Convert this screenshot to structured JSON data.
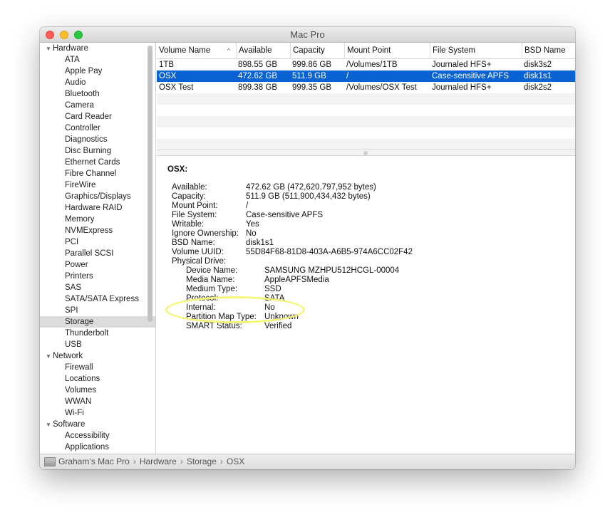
{
  "window": {
    "title": "Mac Pro"
  },
  "sidebar": {
    "groups": [
      {
        "label": "Hardware",
        "items": [
          "ATA",
          "Apple Pay",
          "Audio",
          "Bluetooth",
          "Camera",
          "Card Reader",
          "Controller",
          "Diagnostics",
          "Disc Burning",
          "Ethernet Cards",
          "Fibre Channel",
          "FireWire",
          "Graphics/Displays",
          "Hardware RAID",
          "Memory",
          "NVMExpress",
          "PCI",
          "Parallel SCSI",
          "Power",
          "Printers",
          "SAS",
          "SATA/SATA Express",
          "SPI",
          "Storage",
          "Thunderbolt",
          "USB"
        ]
      },
      {
        "label": "Network",
        "items": [
          "Firewall",
          "Locations",
          "Volumes",
          "WWAN",
          "Wi-Fi"
        ]
      },
      {
        "label": "Software",
        "items": [
          "Accessibility",
          "Applications"
        ]
      }
    ],
    "selected": "Storage"
  },
  "table": {
    "columns": [
      "Volume Name",
      "Available",
      "Capacity",
      "Mount Point",
      "File System",
      "BSD Name"
    ],
    "sort_icon": "chevron-up-icon",
    "rows": [
      [
        "1TB",
        "898.55 GB",
        "999.86 GB",
        "/Volumes/1TB",
        "Journaled HFS+",
        "disk3s2"
      ],
      [
        "OSX",
        "472.62 GB",
        "511.9 GB",
        "/",
        "Case-sensitive APFS",
        "disk1s1"
      ],
      [
        "OSX Test",
        "899.38 GB",
        "999.35 GB",
        "/Volumes/OSX Test",
        "Journaled HFS+",
        "disk2s2"
      ]
    ],
    "selected_row": 1
  },
  "detail": {
    "title": "OSX:",
    "fields": [
      {
        "label": "Available:",
        "value": "472.62 GB (472,620,797,952 bytes)"
      },
      {
        "label": "Capacity:",
        "value": "511.9 GB (511,900,434,432 bytes)"
      },
      {
        "label": "Mount Point:",
        "value": "/"
      },
      {
        "label": "File System:",
        "value": "Case-sensitive APFS"
      },
      {
        "label": "Writable:",
        "value": "Yes"
      },
      {
        "label": "Ignore Ownership:",
        "value": "No"
      },
      {
        "label": "BSD Name:",
        "value": "disk1s1"
      },
      {
        "label": "Volume UUID:",
        "value": "55D84F68-81D8-403A-A6B5-974A6CC02F42"
      },
      {
        "label": "Physical Drive:",
        "value": ""
      }
    ],
    "drive_fields": [
      {
        "label": "Device Name:",
        "value": "SAMSUNG MZHPU512HCGL-00004"
      },
      {
        "label": "Media Name:",
        "value": "AppleAPFSMedia"
      },
      {
        "label": "Medium Type:",
        "value": "SSD"
      },
      {
        "label": "Protocol:",
        "value": "SATA"
      },
      {
        "label": "Internal:",
        "value": "No"
      },
      {
        "label": "Partition Map Type:",
        "value": "Unknown"
      },
      {
        "label": "SMART Status:",
        "value": "Verified"
      }
    ]
  },
  "statusbar": {
    "icon": "computer-icon",
    "path": [
      "Graham’s Mac Pro",
      "Hardware",
      "Storage",
      "OSX"
    ]
  },
  "colors": {
    "selection": "#0a63d2",
    "highlight_ring": "#f5f57a"
  }
}
